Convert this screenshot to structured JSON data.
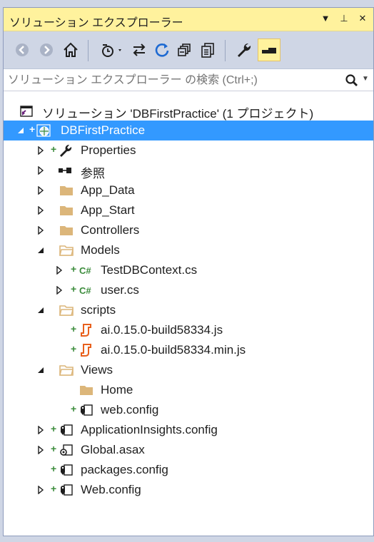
{
  "window": {
    "title": "ソリューション エクスプローラー"
  },
  "titlebar": {
    "dropdown_glyph": "▼",
    "pin_glyph": "⊥",
    "close_glyph": "✕"
  },
  "search": {
    "placeholder": "ソリューション エクスプローラー の検索 (Ctrl+;)"
  },
  "colors": {
    "selection": "#3399ff",
    "title_bg": "#fff29d",
    "toolbar_bg": "#cfd6e5",
    "cs_green": "#3c8c3c",
    "js_orange": "#e8601c"
  },
  "tree": {
    "solution": "ソリューション 'DBFirstPractice' (1 プロジェクト)",
    "project": "DBFirstPractice",
    "properties": "Properties",
    "references": "参照",
    "app_data": "App_Data",
    "app_start": "App_Start",
    "controllers": "Controllers",
    "models": "Models",
    "test_db_context": "TestDBContext.cs",
    "user_cs": "user.cs",
    "scripts": "scripts",
    "ai_js": "ai.0.15.0-build58334.js",
    "ai_min_js": "ai.0.15.0-build58334.min.js",
    "views": "Views",
    "home": "Home",
    "views_web_config": "web.config",
    "app_insights": "ApplicationInsights.config",
    "global_asax": "Global.asax",
    "packages_config": "packages.config",
    "web_config": "Web.config"
  }
}
